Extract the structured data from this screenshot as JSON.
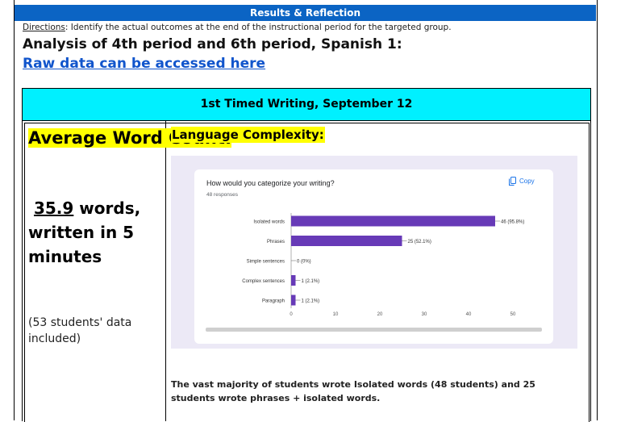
{
  "header": {
    "title": "Results & Reflection"
  },
  "directions": {
    "label": "Directions",
    "text": ": Identify the actual outcomes at the end of the instructional period for the targeted group."
  },
  "analysis_title": "Analysis of 4th period and 6th period, Spanish 1:",
  "raw_link": "Raw data can be accessed here",
  "table": {
    "header": "1st Timed Writing, September 12",
    "left": {
      "title": "Average Word Count:",
      "value_number": "35.9",
      "value_rest": " words, written in 5 minutes",
      "note": "(53 students' data included)"
    },
    "right": {
      "title": "Language Complexity:",
      "summary": "The vast majority of students wrote Isolated words (48 students) and 25 students wrote phrases + isolated words."
    }
  },
  "form": {
    "question": "How would you categorize your writing?",
    "responses": "48 responses",
    "copy_label": "Copy"
  },
  "colors": {
    "bar": "#673ab7",
    "header_blue": "#0b64c4",
    "cyan": "#00f0ff",
    "highlight": "#ffff00"
  },
  "chart_data": {
    "type": "bar",
    "orientation": "horizontal",
    "categories": [
      "Isolated words",
      "Phrases",
      "Simple sentences",
      "Complex sentences",
      "Paragraph"
    ],
    "values": [
      46,
      25,
      0,
      1,
      1
    ],
    "data_labels": [
      "46 (95.8%)",
      "25 (52.1%)",
      "0 (0%)",
      "1 (2.1%)",
      "1 (2.1%)"
    ],
    "xlim": [
      0,
      50
    ],
    "xticks": [
      0,
      10,
      20,
      30,
      40,
      50
    ],
    "grid": false
  }
}
